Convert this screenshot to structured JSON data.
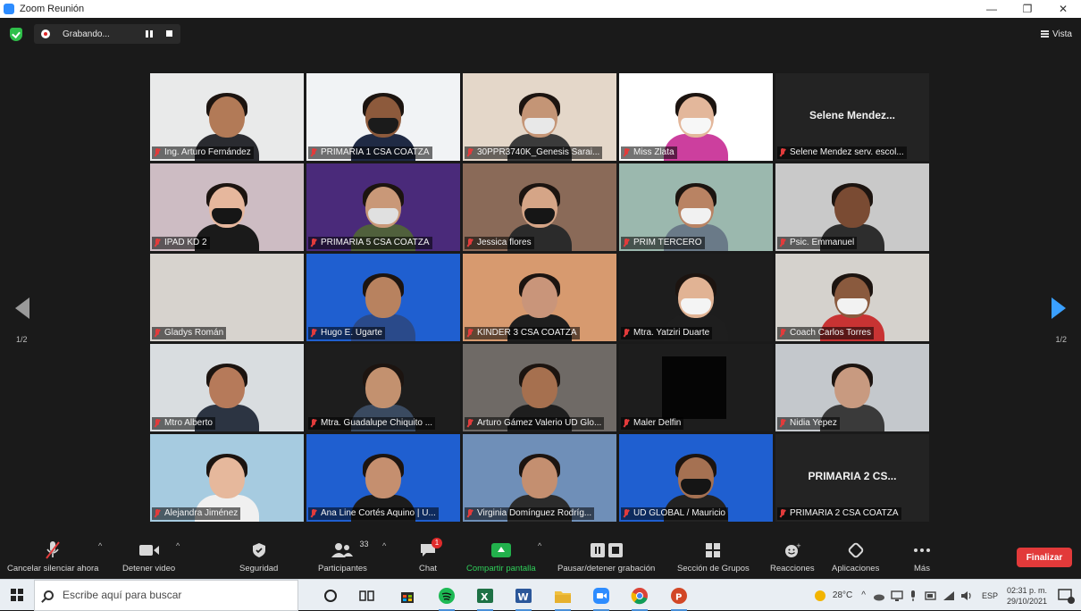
{
  "window": {
    "title": "Zoom Reunión",
    "controls": [
      "—",
      "❐",
      "✕"
    ]
  },
  "topbar": {
    "recording_label": "Grabando...",
    "view_label": "Vista"
  },
  "pagination": {
    "left_label": "1/2",
    "right_label": "1/2"
  },
  "participants": [
    {
      "name": "Ing. Arturo Fernández",
      "muted": true,
      "bg": "#e9eaea",
      "skin": "#b27a57",
      "body": "#2a2b30",
      "mask": ""
    },
    {
      "name": "PRIMARIA 1 CSA COATZA",
      "muted": true,
      "bg": "#f1f3f5",
      "skin": "#8d5a3c",
      "body": "#1f2a44",
      "mask": "#1b1b1b"
    },
    {
      "name": "30PPR3740K_Genesis Sarai...",
      "muted": true,
      "bg": "#e4d7c9",
      "skin": "#c49576",
      "body": "#3b3b3b",
      "mask": "#e8e8e8"
    },
    {
      "name": "Miss Zlata",
      "muted": true,
      "bg": "#ffffff",
      "skin": "#e3b79b",
      "body": "#cc3f9e",
      "mask": "#f7f7f7"
    },
    {
      "name": "Selene Mendez serv. escol...",
      "muted": true,
      "bg": "#232323",
      "skin": "",
      "body": "",
      "mask": "",
      "display_name": "Selene  Mendez..."
    },
    {
      "name": "IPAD KD 2",
      "muted": true,
      "bg": "#cdbcc3",
      "skin": "#e6b79d",
      "body": "#1a1a1a",
      "mask": "#161616"
    },
    {
      "name": "PRIMARIA 5 CSA COATZA",
      "muted": true,
      "bg": "#4a2a7a",
      "skin": "#c99878",
      "body": "#50603c",
      "mask": "#e0e0e0"
    },
    {
      "name": "Jessica flores",
      "muted": true,
      "bg": "#8a6a58",
      "skin": "#d5a587",
      "body": "#2b2b2b",
      "mask": "#161616"
    },
    {
      "name": "PRIM TERCERO",
      "muted": true,
      "bg": "#9bb8ae",
      "skin": "#b98363",
      "body": "#6a7a88",
      "mask": "#f1f1f1"
    },
    {
      "name": "Psic. Emmanuel",
      "muted": true,
      "bg": "#c9c9c9",
      "skin": "#7a4b33",
      "body": "#2d2d2d",
      "mask": ""
    },
    {
      "name": "Gladys Román",
      "muted": true,
      "bg": "#d7d3ce",
      "skin": "",
      "body": "",
      "mask": ""
    },
    {
      "name": "Hugo E. Ugarte",
      "muted": true,
      "bg": "#1f5fd0",
      "skin": "#b8825f",
      "body": "#2a4a8a",
      "mask": ""
    },
    {
      "name": "KINDER 3 CSA COATZA",
      "muted": true,
      "bg": "#d79a6f",
      "skin": "#c9957a",
      "body": "#1e1e1e",
      "mask": ""
    },
    {
      "name": "Mtra. Yatziri Duarte",
      "muted": true,
      "bg": "#1d1d1d",
      "skin": "#e1b394",
      "body": "#1e1e1e",
      "mask": "#f4f4f4"
    },
    {
      "name": "Coach Carlos Torres",
      "muted": true,
      "bg": "#d5d2cd",
      "skin": "#8a5a3e",
      "body": "#c83333",
      "mask": "#f2f2f2"
    },
    {
      "name": "Mtro Alberto",
      "muted": true,
      "bg": "#d9dde0",
      "skin": "#b67a5a",
      "body": "#2c3442",
      "mask": ""
    },
    {
      "name": "Mtra. Guadalupe Chiquito ...",
      "muted": true,
      "bg": "#1d1d1d",
      "skin": "#c3916f",
      "body": "#3a4a60",
      "mask": ""
    },
    {
      "name": "Arturo Gámez Valerio UD Glo...",
      "muted": true,
      "active": true,
      "bg": "#6f6a66",
      "skin": "#a6704f",
      "body": "#1e1e1e",
      "mask": ""
    },
    {
      "name": "Maler Delfin",
      "muted": true,
      "bg": "#1d1d1d",
      "skin": "",
      "body": "",
      "mask": ""
    },
    {
      "name": "Nidia Yepez",
      "muted": true,
      "bg": "#c4c8cc",
      "skin": "#c89a80",
      "body": "#3a3a3a",
      "mask": ""
    },
    {
      "name": "Alejandra Jiménez",
      "muted": true,
      "bg": "#a6cbe0",
      "skin": "#e6b89c",
      "body": "#f0f0f0",
      "mask": ""
    },
    {
      "name": "Ana Line Cortés Aquino | U...",
      "muted": true,
      "bg": "#1f5fd0",
      "skin": "#c58f6f",
      "body": "#1c1c1c",
      "mask": ""
    },
    {
      "name": "Virginia Domínguez Rodríg...",
      "muted": true,
      "bg": "#6f8fb8",
      "skin": "#c48f70",
      "body": "#2b2b2b",
      "mask": ""
    },
    {
      "name": "UD GLOBAL / Mauricio",
      "muted": true,
      "bg": "#1f5fd0",
      "skin": "#a57152",
      "body": "#222222",
      "mask": "#151515"
    },
    {
      "name": "PRIMARIA 2 CSA COATZA",
      "muted": true,
      "bg": "#232323",
      "skin": "",
      "body": "",
      "mask": "",
      "display_name": "PRIMARIA 2 CS..."
    }
  ],
  "toolbar": {
    "unmute_label": "Cancelar silenciar ahora",
    "video_label": "Detener video",
    "security_label": "Seguridad",
    "participants_label": "Participantes",
    "participants_count": "33",
    "chat_label": "Chat",
    "chat_badge": "1",
    "share_label": "Compartir pantalla",
    "record_label": "Pausar/detener grabación",
    "breakout_label": "Sección de Grupos",
    "reactions_label": "Reacciones",
    "apps_label": "Aplicaciones",
    "more_label": "Más",
    "end_label": "Finalizar"
  },
  "taskbar": {
    "search_placeholder": "Escribe aquí para buscar",
    "temperature": "28°C",
    "language": "ESP",
    "time": "02:31 p. m.",
    "date": "29/10/2021"
  },
  "colors": {
    "accent": "#2d8cff",
    "share_green": "#22b14c",
    "end_red": "#e23a3a",
    "active_speaker": "#d8d22c"
  }
}
